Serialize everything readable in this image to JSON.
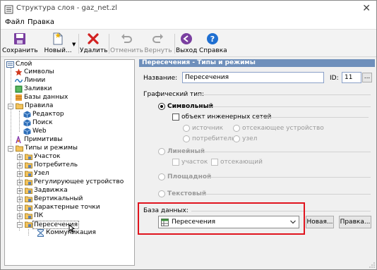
{
  "window": {
    "title": "Структура слоя - gaz_net.zl",
    "close_glyph": "✕"
  },
  "menu": {
    "file": "Файл",
    "edit": "Правка"
  },
  "toolbar": {
    "save": "Сохранить",
    "new": "Новый...",
    "delete": "Удалить",
    "undo": "Отменить",
    "redo": "Вернуть",
    "exit": "Выход",
    "help": "Справка"
  },
  "tree": {
    "layer": "Слой",
    "symbols": "Символы",
    "lines": "Линии",
    "fills": "Заливки",
    "databases": "Базы данных",
    "rules": "Правила",
    "editor": "Редактор",
    "search": "Поиск",
    "web": "Web",
    "primitives": "Примитивы",
    "types_modes": "Типы и режимы",
    "section": "Участок",
    "consumer": "Потребитель",
    "node": "Узел",
    "regulator": "Регулирующее устройство",
    "valve": "Задвижка",
    "vertical": "Вертикальный",
    "char_points": "Характерные точки",
    "pk": "ПК",
    "intersections": "Пересечения",
    "communication": "Коммуникация"
  },
  "panel": {
    "header": "Пересечения - Типы и режимы",
    "name_label": "Название:",
    "name_value": "Пересечения",
    "id_label": "ID:",
    "id_value": "11",
    "dots": "...",
    "graphic_type_label": "Графический тип:",
    "symbolic": "Символьный",
    "eng_object": "объект инженерных сетей",
    "source": "источник",
    "shutoff_device": "отсекающее устройство",
    "consumer": "потребитель",
    "node": "узел",
    "linear": "Линейный",
    "section": "участок",
    "shutoff": "отсекающий",
    "area": "Площадной",
    "text": "Текстовый",
    "db_label": "База данных:",
    "db_value": "Пересечения",
    "new_btn": "Новая...",
    "edit_btn": "Правка..."
  },
  "colors": {
    "header_bg": "#6e8fbb",
    "highlight": "#e0141e"
  }
}
